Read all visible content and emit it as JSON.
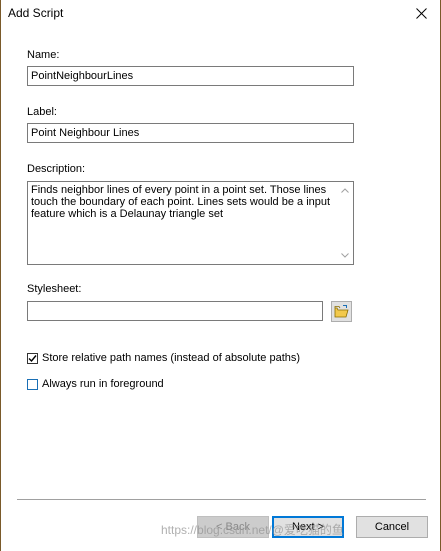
{
  "window": {
    "title": "Add Script"
  },
  "form": {
    "name_label": "Name:",
    "name_value": "PointNeighbourLines",
    "label_label": "Label:",
    "label_value": "Point Neighbour Lines",
    "description_label": "Description:",
    "description_value": "Finds neighbor lines of every point in a point set. Those lines touch the boundary of each point. Lines sets would be a input feature which is a Delaunay triangle set",
    "stylesheet_label": "Stylesheet:",
    "stylesheet_value": ""
  },
  "options": {
    "relative_paths_label": "Store relative path names (instead of absolute paths)",
    "relative_paths_checked": true,
    "foreground_label": "Always run in foreground",
    "foreground_checked": false
  },
  "buttons": {
    "back_label": "< Back",
    "next_label": "Next >",
    "cancel_label": "Cancel"
  },
  "watermark": "https://blog.csdn.net/@爱吃猫的鱼",
  "icons": {
    "close": "close-icon",
    "folder": "open-folder-icon",
    "scroll_up": "scroll-up-arrow-icon",
    "scroll_down": "scroll-down-arrow-icon",
    "check": "check-icon"
  },
  "colors": {
    "accent": "#0078d7",
    "folder": "#e8b300"
  }
}
